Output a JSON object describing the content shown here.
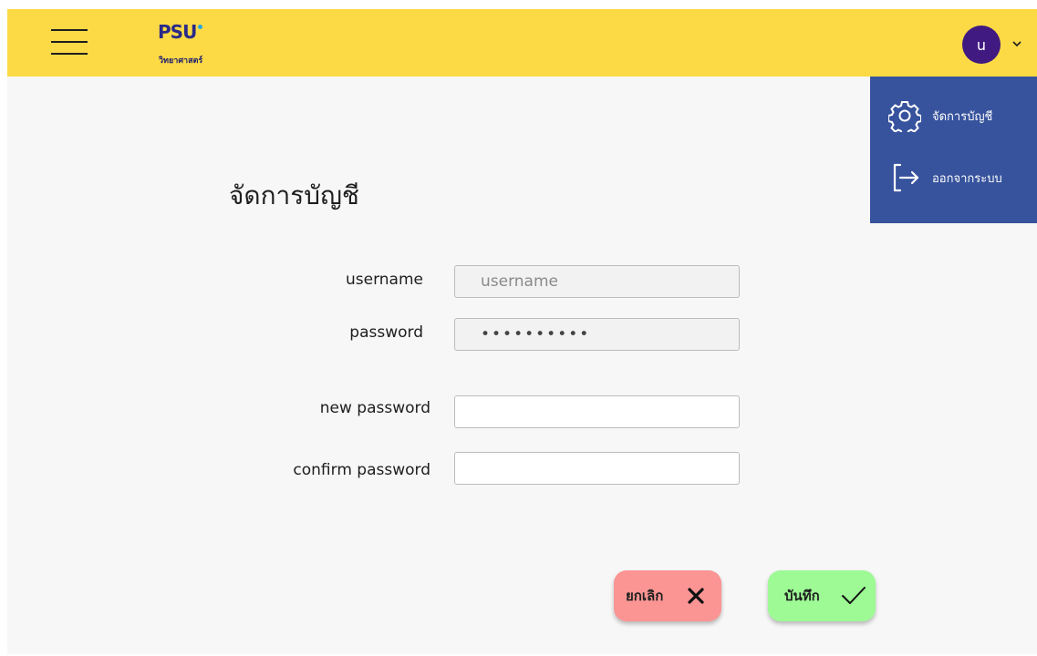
{
  "header": {
    "logo_mark": "PSU",
    "logo_subtitle": "วิทยาศาสตร์",
    "avatar_initial": "u",
    "brand_color": "#fcda45"
  },
  "menu": {
    "items": [
      {
        "label": "จัดการบัญชี",
        "icon": "gear-icon"
      },
      {
        "label": "ออกจากระบบ",
        "icon": "logout-icon"
      }
    ],
    "bg_color": "#37539d"
  },
  "form": {
    "title": "จัดการบัญชี",
    "username_label": "username",
    "username_value": "username",
    "password_label": "password",
    "password_value": "••••••••••",
    "new_password_label": "new password",
    "new_password_value": "",
    "confirm_password_label": "confirm password",
    "confirm_password_value": ""
  },
  "actions": {
    "cancel_label": "ยกเลิก",
    "cancel_icon": "close-icon",
    "cancel_color": "#fa9594",
    "save_label": "บันทึก",
    "save_icon": "check-icon",
    "save_color": "#9dfa95"
  }
}
